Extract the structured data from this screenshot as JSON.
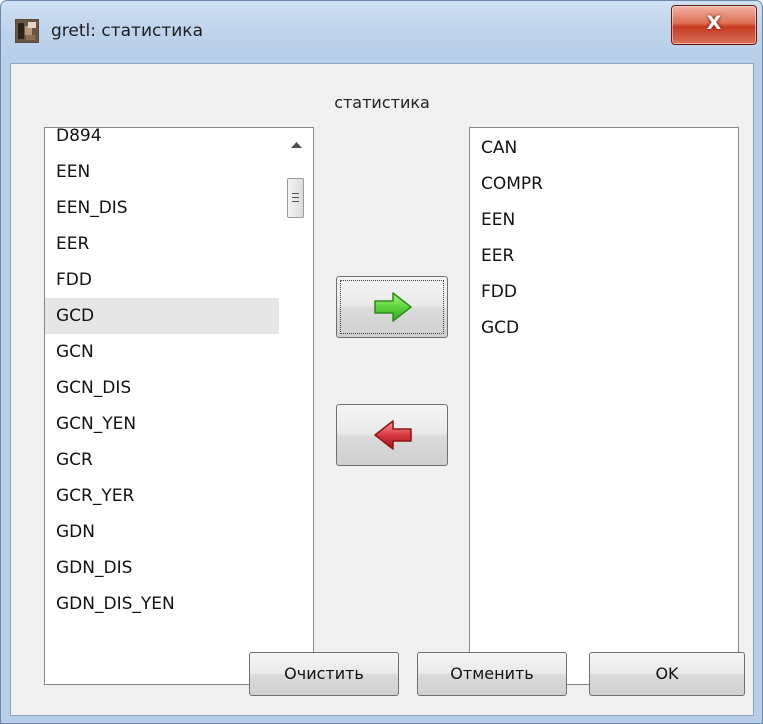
{
  "window": {
    "title": "gretl: статистика",
    "close_label": "X"
  },
  "dialog": {
    "caption": "статистика"
  },
  "available": {
    "items": [
      "D894",
      "EEN",
      "EEN_DIS",
      "EER",
      "FDD",
      "GCD",
      "GCN",
      "GCN_DIS",
      "GCN_YEN",
      "GCR",
      "GCR_YER",
      "GDN",
      "GDN_DIS",
      "GDN_DIS_YEN"
    ],
    "selected": "GCD"
  },
  "chosen": {
    "items": [
      "CAN",
      "COMPR",
      "EEN",
      "EER",
      "FDD",
      "GCD"
    ]
  },
  "buttons": {
    "add_icon": "green-arrow-right-icon",
    "remove_icon": "red-arrow-left-icon",
    "clear_label": "Очистить",
    "cancel_label": "Отменить",
    "ok_label": "OK"
  },
  "colors": {
    "add_arrow": "#5fd43f",
    "remove_arrow": "#d8383f",
    "title_bar": "#bfd3ec",
    "close_button": "#c63a20"
  }
}
